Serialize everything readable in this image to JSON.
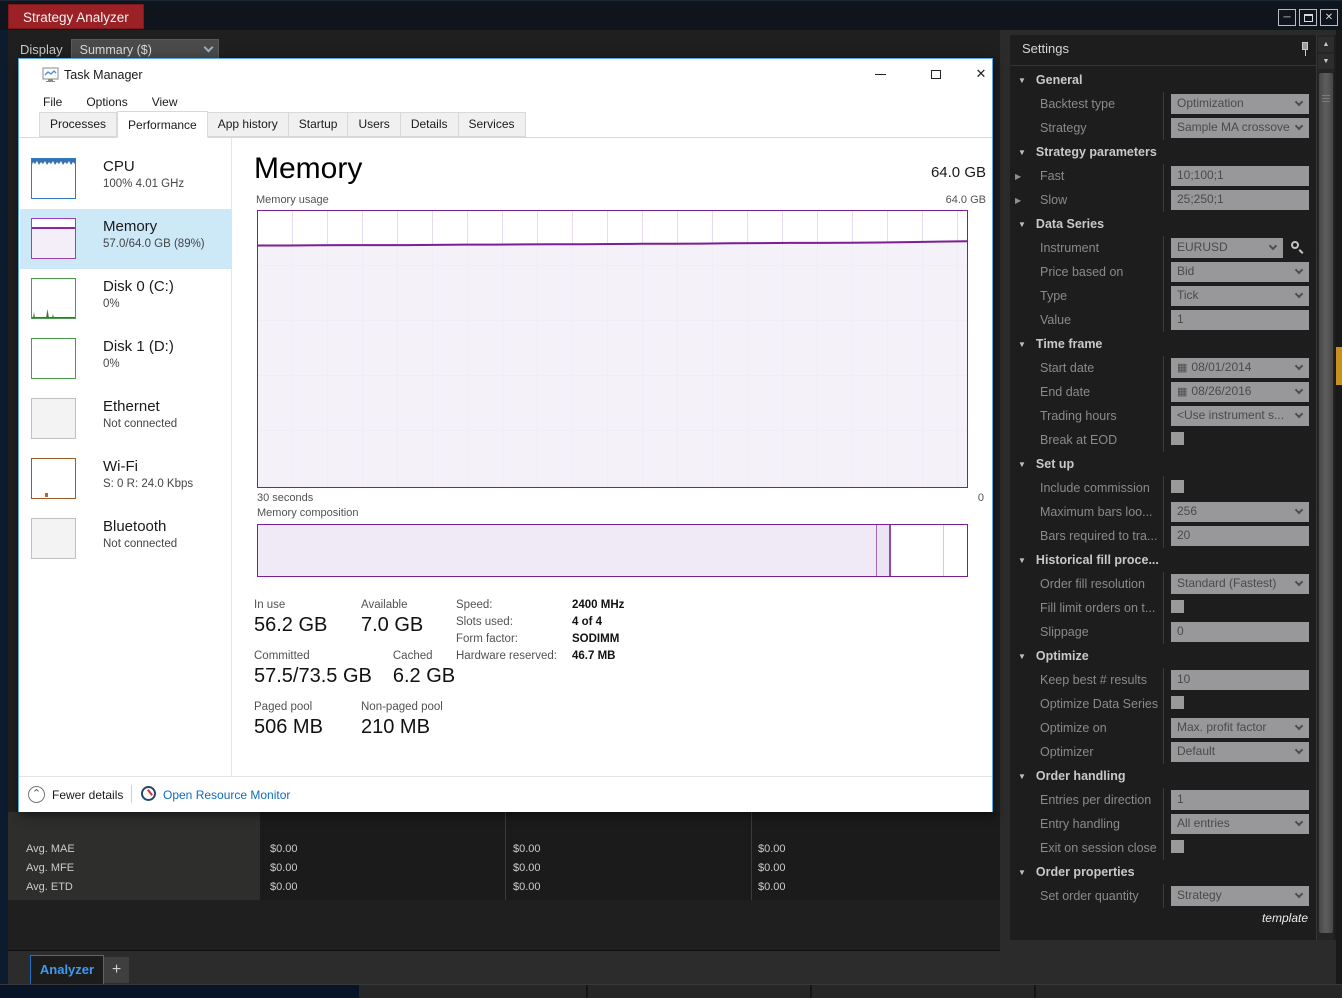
{
  "glyphs": {
    "minimize": "─",
    "close": "✕",
    "scroll_up": "▲",
    "scroll_down": "▼",
    "group_collapse": "▼",
    "row_expand": "▶",
    "fewer_chevron": "⌃",
    "calendar": "▦"
  },
  "titlebar": {
    "title": "Strategy Analyzer"
  },
  "analyzer": {
    "display_label": "Display",
    "display_value": "Summary ($)",
    "stats_table": {
      "rows": [
        {
          "label": "Avg. MAE",
          "values": [
            "$0.00",
            "$0.00",
            "$0.00"
          ]
        },
        {
          "label": "Avg. MFE",
          "values": [
            "$0.00",
            "$0.00",
            "$0.00"
          ]
        },
        {
          "label": "Avg. ETD",
          "values": [
            "$0.00",
            "$0.00",
            "$0.00"
          ]
        }
      ]
    },
    "bottom_tabs": {
      "active": "Analyzer",
      "add": "+"
    }
  },
  "task_manager": {
    "window_title": "Task Manager",
    "menu_items": [
      "File",
      "Options",
      "View"
    ],
    "tabs": [
      "Processes",
      "Performance",
      "App history",
      "Startup",
      "Users",
      "Details",
      "Services"
    ],
    "active_tab": "Performance",
    "sidebar_items": [
      {
        "type": "cpu",
        "name": "CPU",
        "detail": "100% 4.01 GHz",
        "selected": false
      },
      {
        "type": "memory",
        "name": "Memory",
        "detail": "57.0/64.0 GB (89%)",
        "selected": true
      },
      {
        "type": "disk0",
        "name": "Disk 0 (C:)",
        "detail": "0%",
        "selected": false
      },
      {
        "type": "disk1",
        "name": "Disk 1 (D:)",
        "detail": "0%",
        "selected": false
      },
      {
        "type": "ethernet",
        "name": "Ethernet",
        "detail": "Not connected",
        "selected": false
      },
      {
        "type": "wifi",
        "name": "Wi-Fi",
        "detail": "S: 0 R: 24.0 Kbps",
        "selected": false
      },
      {
        "type": "bluetooth",
        "name": "Bluetooth",
        "detail": "Not connected",
        "selected": false
      }
    ],
    "memory_pane": {
      "title": "Memory",
      "capacity": "64.0 GB",
      "usage_chart_label": "Memory usage",
      "usage_chart_max": "64.0 GB",
      "usage_chart_time": "30 seconds",
      "usage_chart_end": "0",
      "composition_label": "Memory composition",
      "capacity_gb": 64,
      "usage_series_gb": [
        56.0,
        56.0,
        56.05,
        56.1,
        56.1,
        56.1,
        56.15,
        56.2,
        56.2,
        56.25,
        56.3,
        56.3,
        56.35,
        56.4,
        56.4,
        56.45,
        56.5,
        56.55,
        56.6,
        56.6,
        56.65,
        56.7,
        56.8,
        56.9,
        57.0
      ],
      "composition_segments": [
        {
          "kind": "in-use",
          "pct": 87.3
        },
        {
          "kind": "modified",
          "pct": 2.0
        },
        {
          "kind": "standby",
          "pct": 7.5
        },
        {
          "kind": "free",
          "pct": 3.2
        }
      ],
      "big_stats": [
        {
          "label": "In use",
          "value": "56.2 GB"
        },
        {
          "label": "Available",
          "value": "7.0 GB"
        },
        {
          "label": "Committed",
          "value": "57.5/73.5 GB"
        },
        {
          "label": "Cached",
          "value": "6.2 GB"
        },
        {
          "label": "Paged pool",
          "value": "506 MB"
        },
        {
          "label": "Non-paged pool",
          "value": "210 MB"
        }
      ],
      "info_stats": [
        {
          "label": "Speed:",
          "value": "2400 MHz"
        },
        {
          "label": "Slots used:",
          "value": "4 of 4"
        },
        {
          "label": "Form factor:",
          "value": "SODIMM"
        },
        {
          "label": "Hardware reserved:",
          "value": "46.7 MB"
        }
      ]
    },
    "footer": {
      "fewer_details": "Fewer details",
      "open_resource_monitor": "Open Resource Monitor"
    }
  },
  "settings_panel": {
    "title": "Settings",
    "template_label": "template",
    "groups": [
      {
        "header": "General",
        "rows": [
          {
            "label": "Backtest type",
            "control": "dropdown",
            "value": "Optimization"
          },
          {
            "label": "Strategy",
            "control": "dropdown",
            "value": "Sample MA crossove"
          }
        ]
      },
      {
        "header": "Strategy parameters",
        "rows": [
          {
            "label": "Fast",
            "control": "input",
            "value": "10;100;1",
            "expandable": true
          },
          {
            "label": "Slow",
            "control": "input",
            "value": "25;250;1",
            "expandable": true
          }
        ]
      },
      {
        "header": "Data Series",
        "rows": [
          {
            "label": "Instrument",
            "control": "dropdown-search",
            "value": "EURUSD"
          },
          {
            "label": "Price based on",
            "control": "dropdown",
            "value": "Bid"
          },
          {
            "label": "Type",
            "control": "dropdown",
            "value": "Tick"
          },
          {
            "label": "Value",
            "control": "input",
            "value": "1"
          }
        ]
      },
      {
        "header": "Time frame",
        "rows": [
          {
            "label": "Start date",
            "control": "date",
            "value": "08/01/2014"
          },
          {
            "label": "End date",
            "control": "date",
            "value": "08/26/2016"
          },
          {
            "label": "Trading hours",
            "control": "dropdown",
            "value": "<Use instrument s..."
          },
          {
            "label": "Break at EOD",
            "control": "checkbox",
            "value": ""
          }
        ]
      },
      {
        "header": "Set up",
        "rows": [
          {
            "label": "Include commission",
            "control": "checkbox",
            "value": ""
          },
          {
            "label": "Maximum bars loo...",
            "control": "dropdown",
            "value": "256"
          },
          {
            "label": "Bars required to tra...",
            "control": "input",
            "value": "20"
          }
        ]
      },
      {
        "header": "Historical fill proce...",
        "rows": [
          {
            "label": "Order fill resolution",
            "control": "dropdown",
            "value": "Standard (Fastest)"
          },
          {
            "label": "Fill limit orders on t...",
            "control": "checkbox",
            "value": ""
          },
          {
            "label": "Slippage",
            "control": "input",
            "value": "0"
          }
        ]
      },
      {
        "header": "Optimize",
        "rows": [
          {
            "label": "Keep best # results",
            "control": "input",
            "value": "10"
          },
          {
            "label": "Optimize Data Series",
            "control": "checkbox",
            "value": ""
          },
          {
            "label": "Optimize on",
            "control": "dropdown",
            "value": "Max. profit factor"
          },
          {
            "label": "Optimizer",
            "control": "dropdown",
            "value": "Default"
          }
        ]
      },
      {
        "header": "Order handling",
        "rows": [
          {
            "label": "Entries per direction",
            "control": "input",
            "value": "1"
          },
          {
            "label": "Entry handling",
            "control": "dropdown",
            "value": "All entries"
          },
          {
            "label": "Exit on session close",
            "control": "checkbox",
            "value": ""
          }
        ]
      },
      {
        "header": "Order properties",
        "rows": [
          {
            "label": "Set order quantity",
            "control": "dropdown",
            "value": "Strategy"
          }
        ]
      }
    ]
  }
}
